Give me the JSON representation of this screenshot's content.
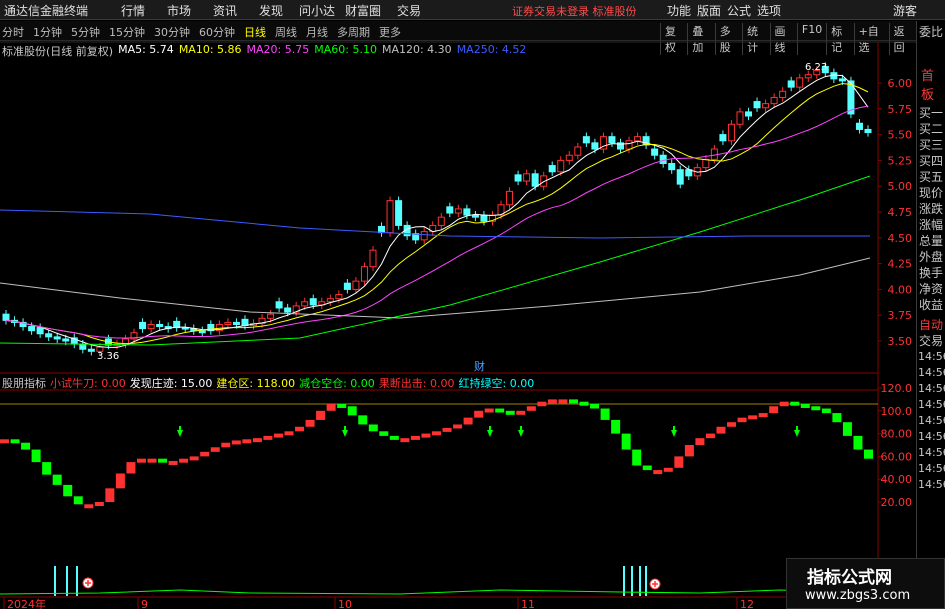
{
  "app": {
    "brand": "通达信金融终端",
    "menu": [
      "行情",
      "市场",
      "资讯",
      "发现",
      "问小达",
      "财富圈",
      "交易"
    ],
    "notice": "证券交易未登录  标准股份",
    "right_menu": [
      "功能",
      "版面",
      "公式",
      "选项"
    ],
    "guest": "游客"
  },
  "periods": {
    "items": [
      "分时",
      "1分钟",
      "5分钟",
      "15分钟",
      "30分钟",
      "60分钟",
      "日线",
      "周线",
      "月线",
      "多周期",
      "更多"
    ],
    "active": "日线"
  },
  "tools": [
    "复权",
    "叠加",
    "多股",
    "统计",
    "画线",
    "F10",
    "标记",
    "+自选",
    "返回"
  ],
  "main_chart": {
    "title": "标准股份(日线 前复权)",
    "ma": [
      {
        "label": "MA5: 5.74",
        "color": "#ffffff"
      },
      {
        "label": "MA10: 5.86",
        "color": "#ffff00"
      },
      {
        "label": "MA20: 5.75",
        "color": "#ff44ff"
      },
      {
        "label": "MA60: 5.10",
        "color": "#00ff00"
      },
      {
        "label": "MA120: 4.30",
        "color": "#c0c0c0"
      },
      {
        "label": "MA250: 4.52",
        "color": "#3c5cff"
      }
    ],
    "y_ticks": [
      "6.00",
      "5.75",
      "5.50",
      "5.25",
      "5.00",
      "4.75",
      "4.50",
      "4.25",
      "4.00",
      "3.75",
      "3.50"
    ],
    "high_label": "6.23",
    "low_label": "3.36",
    "event_label": "财"
  },
  "indicator": {
    "name": "股朋指标",
    "fields": [
      {
        "label": "小试牛刀: 0.00",
        "color": "#ff3030"
      },
      {
        "label": "发现庄迹: 15.00",
        "color": "#ffffff"
      },
      {
        "label": "建仓区: 118.00",
        "color": "#ffff00"
      },
      {
        "label": "减仓空仓: 0.00",
        "color": "#00ff00"
      },
      {
        "label": "果断出击: 0.00",
        "color": "#ff3030"
      },
      {
        "label": "红持绿空: 0.00",
        "color": "#00ffff"
      }
    ],
    "y_ticks": [
      "120.0",
      "100.0",
      "80.00",
      "60.00",
      "40.00",
      "20.00"
    ]
  },
  "date_axis": [
    "2024年",
    "9",
    "10",
    "11",
    "12"
  ],
  "side_panel": {
    "header": "委比",
    "big": "首板",
    "items": [
      "买一",
      "买二",
      "买三",
      "买四",
      "买五",
      "现价",
      "涨跌",
      "涨幅",
      "总量",
      "外盘",
      "换手",
      "净资",
      "收益"
    ],
    "footer_title": "自动",
    "footer_sub": "交易",
    "times": [
      "14:56",
      "14:56",
      "14:56",
      "14:56",
      "14:56",
      "14:56",
      "14:56",
      "14:56",
      "14:56"
    ]
  },
  "watermark": {
    "line1": "指标公式网",
    "line2": "www.zbgs3.com"
  },
  "colors": {
    "up": "#ff3232",
    "down": "#54ffff",
    "green": "#00ff00",
    "axis": "#8a0000"
  }
}
